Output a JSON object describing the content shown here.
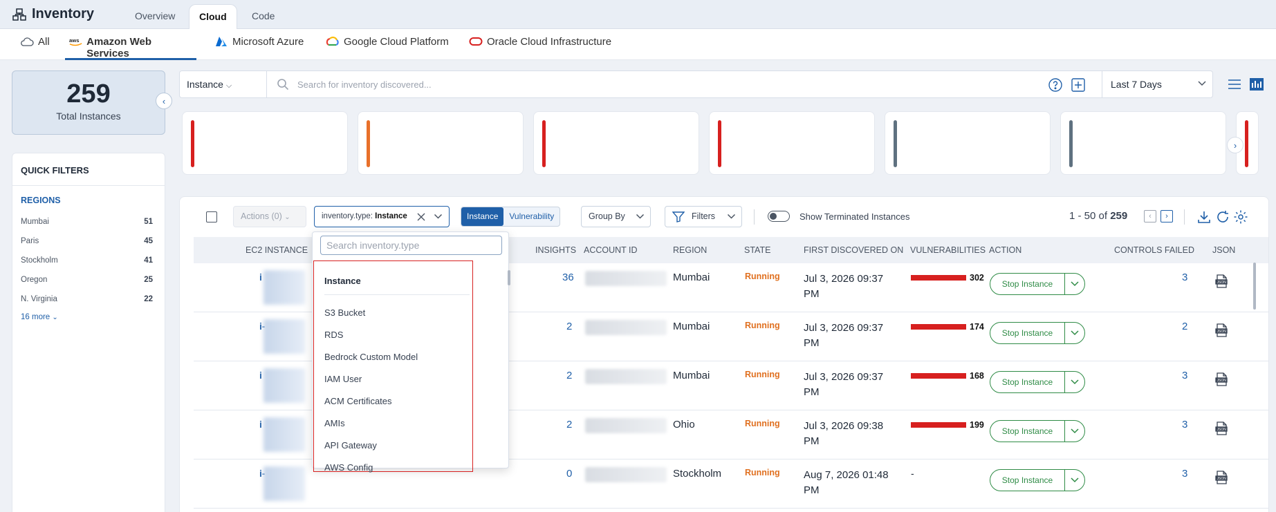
{
  "app": {
    "title": "Inventory"
  },
  "top_tabs": [
    {
      "label": "Overview",
      "active": false
    },
    {
      "label": "Cloud",
      "active": true
    },
    {
      "label": "Code",
      "active": false
    }
  ],
  "providers": [
    {
      "label": "All",
      "icon": "cloud-icon",
      "active": false
    },
    {
      "label": "Amazon Web Services",
      "icon": "aws-logo-icon",
      "active": true
    },
    {
      "label": "Microsoft Azure",
      "icon": "azure-logo-icon",
      "active": false
    },
    {
      "label": "Google Cloud Platform",
      "icon": "gcp-logo-icon",
      "active": false
    },
    {
      "label": "Oracle Cloud Infrastructure",
      "icon": "oracle-logo-icon",
      "active": false
    }
  ],
  "summary": {
    "count": "259",
    "label": "Total Instances"
  },
  "quick_filters": {
    "title": "QUICK FILTERS",
    "regions_title": "REGIONS",
    "regions": [
      {
        "name": "Mumbai",
        "count": "51"
      },
      {
        "name": "Paris",
        "count": "45"
      },
      {
        "name": "Stockholm",
        "count": "41"
      },
      {
        "name": "Oregon",
        "count": "25"
      },
      {
        "name": "N. Virginia",
        "count": "22"
      }
    ],
    "more_label": "16 more"
  },
  "search": {
    "type_value": "Instance",
    "placeholder": "Search for inventory discovered...",
    "date_range": "Last 7 Days"
  },
  "insight_cards": [
    {
      "color": "#d7201f"
    },
    {
      "color": "#e8702a"
    },
    {
      "color": "#d7201f"
    },
    {
      "color": "#d7201f"
    },
    {
      "color": "#5f7180"
    },
    {
      "color": "#5f7180"
    },
    {
      "color": "#d7201f"
    }
  ],
  "toolbar": {
    "actions_label": "Actions (0)",
    "filter_key": "inventory.type:",
    "filter_value": "Instance",
    "seg_instance": "Instance",
    "seg_vulnerability": "Vulnerability",
    "group_by": "Group By",
    "filters": "Filters",
    "show_terminated": "Show Terminated Instances",
    "pager_range": "1 - 50 of",
    "pager_total": "259"
  },
  "table": {
    "headers": {
      "ec2": "EC2 INSTANCE",
      "insights": "INSIGHTS",
      "account": "ACCOUNT ID",
      "region": "REGION",
      "state": "STATE",
      "first": "FIRST DISCOVERED ON",
      "vulns": "VULNERABILITIES",
      "action": "ACTION",
      "controls": "CONTROLS FAILED",
      "json": "JSON"
    },
    "rows": [
      {
        "id": "i",
        "insights": "36",
        "region": "Mumbai",
        "state": "Running",
        "date1": "Jul 3, 2026 09:37",
        "date2": "PM",
        "vulns": "302",
        "vuln_pct": 1.0,
        "action": "Stop Instance",
        "controls": "3"
      },
      {
        "id": "i-",
        "insights": "2",
        "region": "Mumbai",
        "state": "Running",
        "date1": "Jul 3, 2026 09:37",
        "date2": "PM",
        "vulns": "174",
        "vuln_pct": 1.0,
        "action": "Stop Instance",
        "controls": "2"
      },
      {
        "id": "i",
        "insights": "2",
        "region": "Mumbai",
        "state": "Running",
        "date1": "Jul 3, 2026 09:37",
        "date2": "PM",
        "vulns": "168",
        "vuln_pct": 1.0,
        "action": "Stop Instance",
        "controls": "3"
      },
      {
        "id": "i",
        "insights": "2",
        "region": "Ohio",
        "state": "Running",
        "date1": "Jul 3, 2026 09:38",
        "date2": "PM",
        "vulns": "199",
        "vuln_pct": 1.0,
        "action": "Stop Instance",
        "controls": "3"
      },
      {
        "id": "i-",
        "insights": "0",
        "region": "Stockholm",
        "state": "Running",
        "date1": "Aug 7, 2026 01:48",
        "date2": "PM",
        "vulns": "-",
        "vuln_pct": 0,
        "action": "Stop Instance",
        "controls": "3"
      }
    ]
  },
  "dropdown": {
    "search_placeholder": "Search inventory.type",
    "selected": "Instance",
    "items": [
      "S3 Bucket",
      "RDS",
      "Bedrock Custom Model",
      "IAM User",
      "ACM Certificates",
      "AMIs",
      "API Gateway",
      "AWS Config"
    ]
  }
}
